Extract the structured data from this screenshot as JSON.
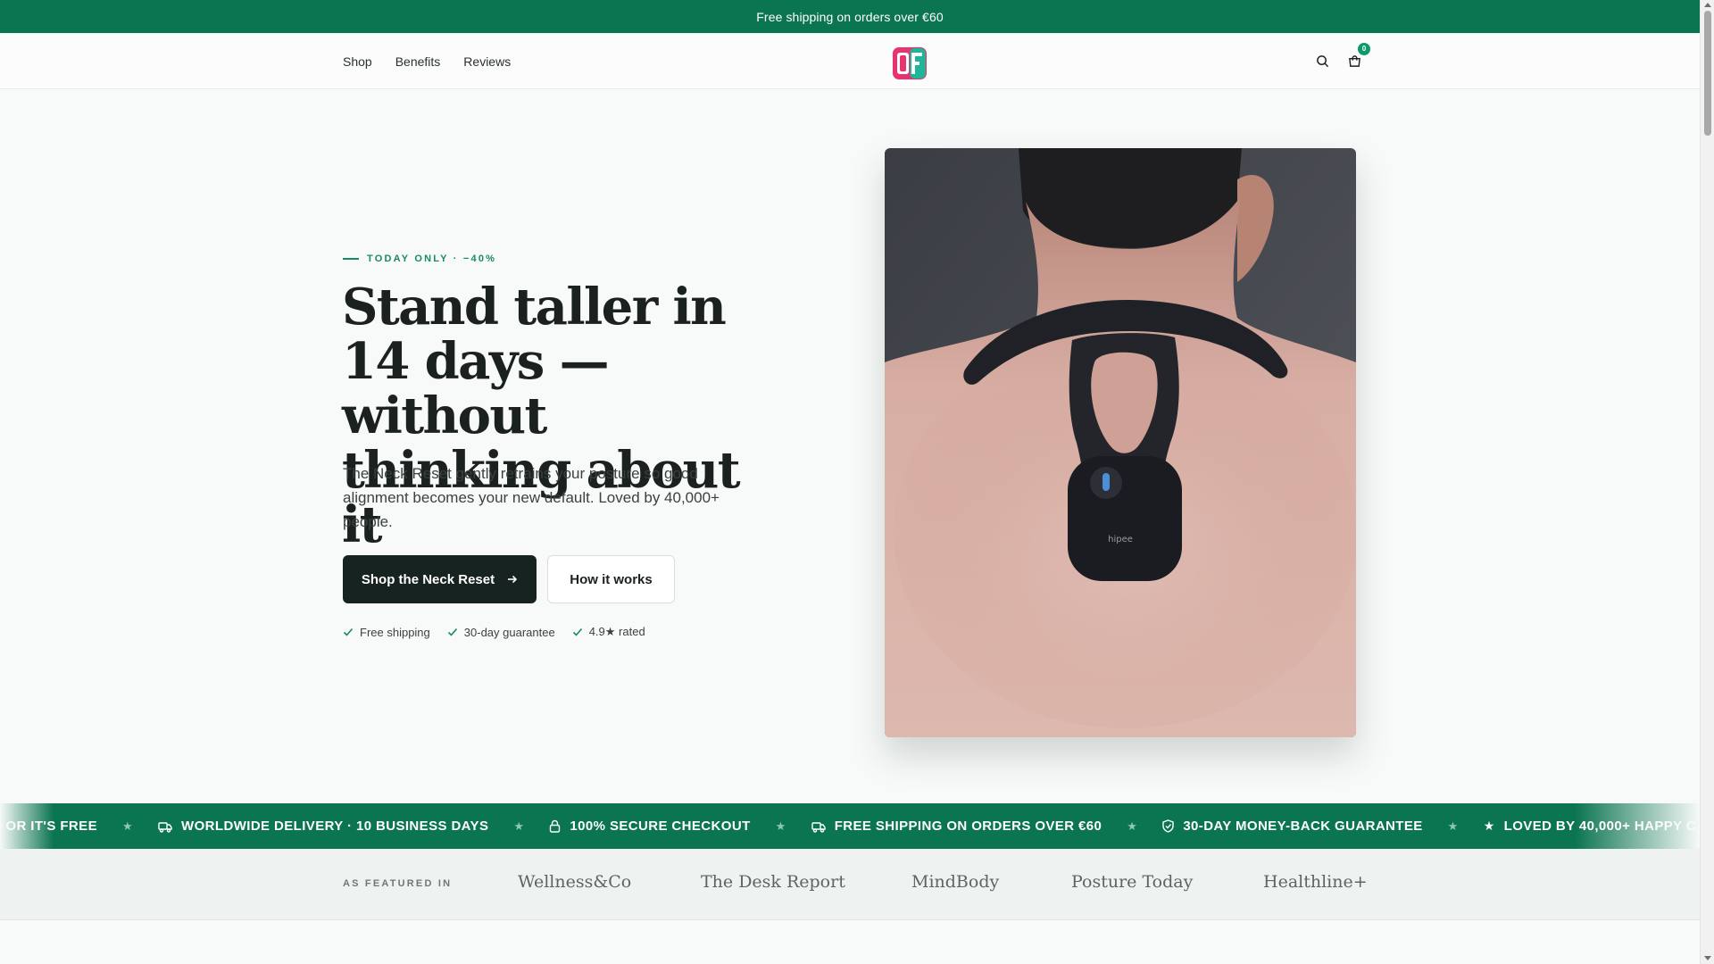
{
  "announcement": {
    "text": "Free shipping on orders over €60"
  },
  "nav": {
    "items": [
      {
        "label": "Shop"
      },
      {
        "label": "Benefits"
      },
      {
        "label": "Reviews"
      }
    ],
    "cart_count": "0"
  },
  "hero": {
    "eyebrow": "TODAY ONLY · −40%",
    "headline": "Stand taller in 14 days — without thinking about it",
    "subcopy": "The Neck Reset gently retrains your posture so good alignment becomes your new default. Loved by 40,000+ people.",
    "primary_cta": "Shop the Neck Reset",
    "secondary_cta": "How it works",
    "trust": [
      {
        "label": "Free shipping"
      },
      {
        "label": "30-day guarantee"
      },
      {
        "label": "4.9★ rated"
      }
    ],
    "product_brand_mark": "hipee"
  },
  "marquee": {
    "items": [
      {
        "icon": "star-icon",
        "label": "DAYS — OR IT'S FREE"
      },
      {
        "icon": "truck-icon",
        "label": "WORLDWIDE DELIVERY · 10 BUSINESS DAYS"
      },
      {
        "icon": "lock-icon",
        "label": "100% SECURE CHECKOUT"
      },
      {
        "icon": "truck-icon",
        "label": "FREE SHIPPING ON ORDERS OVER €60"
      },
      {
        "icon": "shield-icon",
        "label": "30-DAY MONEY-BACK GUARANTEE"
      },
      {
        "icon": "star-icon",
        "label": "LOVED BY 40,000+ HAPPY C"
      }
    ]
  },
  "featured": {
    "label": "AS FEATURED IN",
    "outlets": [
      {
        "name": "Wellness&Co"
      },
      {
        "name": "The Desk Report"
      },
      {
        "name": "MindBody"
      },
      {
        "name": "Posture Today"
      },
      {
        "name": "Healthline+"
      }
    ]
  },
  "colors": {
    "brand_green": "#0b7450",
    "accent_green": "#1a8a5f",
    "primary_button": "#172320",
    "page_background": "#f7faf8"
  }
}
